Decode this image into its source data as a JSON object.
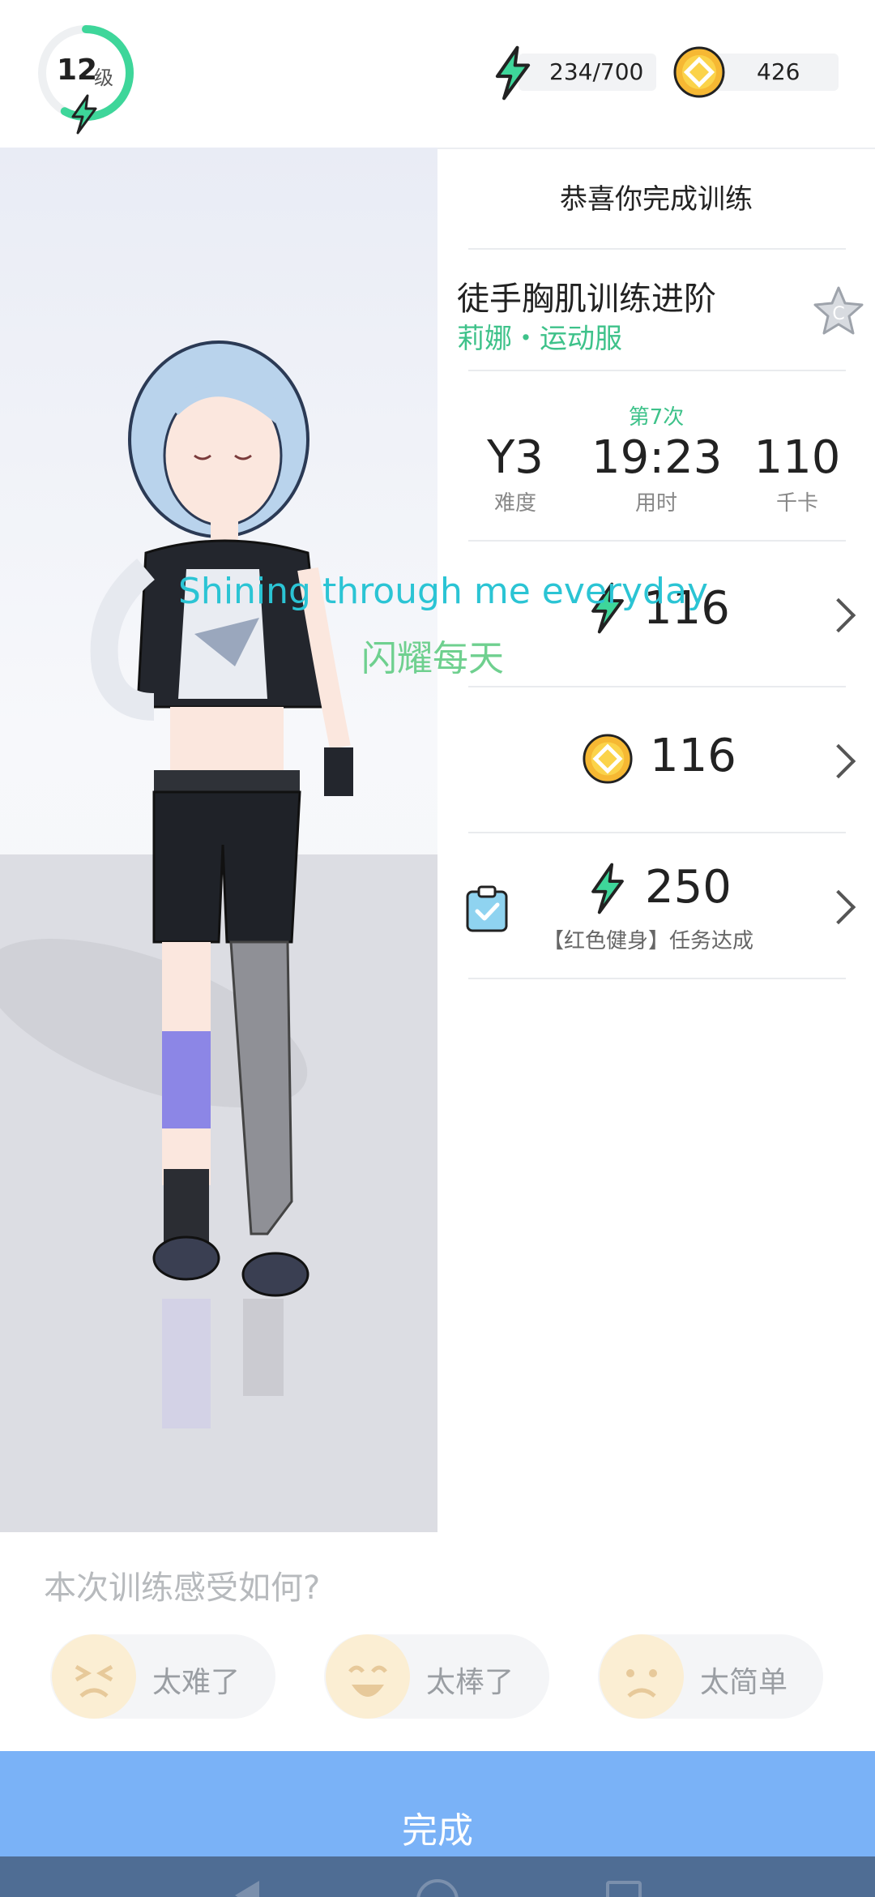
{
  "header": {
    "level_number": "12",
    "level_unit": "级",
    "level_progress": 0.58,
    "energy": "234/700",
    "coins": "426",
    "accent_color": "#3ec28a"
  },
  "result": {
    "congrats": "恭喜你完成训练",
    "course_title": "徒手胸肌训练进阶",
    "course_subtitle": "莉娜・运动服",
    "grade": "C",
    "times_label": "第7次",
    "stats": [
      {
        "value": "Y3",
        "label": "难度"
      },
      {
        "value": "19:23",
        "label": "用时"
      },
      {
        "value": "110",
        "label": "千卡"
      }
    ],
    "rewards": [
      {
        "icon": "energy-bolt-icon",
        "value": "116"
      },
      {
        "icon": "coin-icon",
        "value": "116"
      },
      {
        "icon": "energy-bolt-icon",
        "value": "250",
        "caption": "【红色健身】任务达成"
      }
    ]
  },
  "lyrics": {
    "english": "Shining through me everyday",
    "chinese": "闪耀每天"
  },
  "feedback": {
    "question": "本次训练感受如何?",
    "options": [
      {
        "label": "太难了",
        "face": "tired-face-icon"
      },
      {
        "label": "太棒了",
        "face": "laughing-face-icon"
      },
      {
        "label": "太简单",
        "face": "sad-face-icon"
      }
    ]
  },
  "done_button": "完成"
}
